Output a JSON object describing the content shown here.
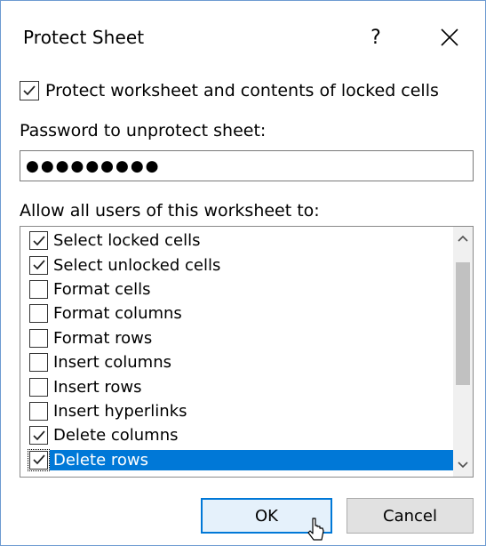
{
  "dialog": {
    "title": "Protect Sheet",
    "help_glyph": "?",
    "close_glyph": "×"
  },
  "protect": {
    "label": "Protect worksheet and contents of locked cells",
    "checked": true
  },
  "password": {
    "label": "Password to unprotect sheet:",
    "masked_value": "●●●●●●●●●"
  },
  "permissions": {
    "label": "Allow all users of this worksheet to:",
    "items": [
      {
        "label": "Select locked cells",
        "checked": true,
        "selected": false
      },
      {
        "label": "Select unlocked cells",
        "checked": true,
        "selected": false
      },
      {
        "label": "Format cells",
        "checked": false,
        "selected": false
      },
      {
        "label": "Format columns",
        "checked": false,
        "selected": false
      },
      {
        "label": "Format rows",
        "checked": false,
        "selected": false
      },
      {
        "label": "Insert columns",
        "checked": false,
        "selected": false
      },
      {
        "label": "Insert rows",
        "checked": false,
        "selected": false
      },
      {
        "label": "Insert hyperlinks",
        "checked": false,
        "selected": false
      },
      {
        "label": "Delete columns",
        "checked": true,
        "selected": false
      },
      {
        "label": "Delete rows",
        "checked": true,
        "selected": true
      }
    ]
  },
  "buttons": {
    "ok_label": "OK",
    "cancel_label": "Cancel"
  },
  "colors": {
    "accent": "#0078d7",
    "window_border": "#6d9bd1",
    "scrollbar_track": "#f0f0f0",
    "scrollbar_thumb": "#c1c1c1"
  },
  "icons": {
    "close": "close-icon",
    "help": "help-icon",
    "checkmark": "checkmark-icon",
    "scroll_up": "chevron-up-icon",
    "scroll_down": "chevron-down-icon",
    "cursor": "mouse-pointer-icon"
  }
}
